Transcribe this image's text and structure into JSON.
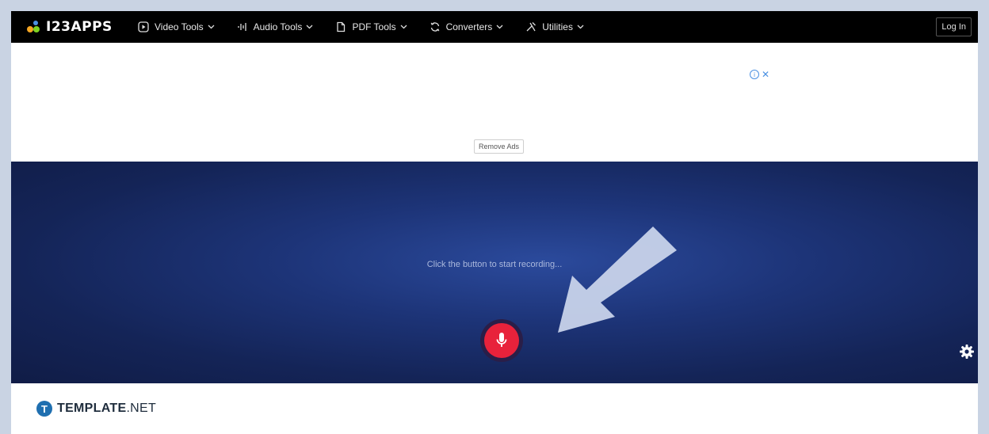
{
  "nav": {
    "logo_text": "I23APPS",
    "items": [
      {
        "label": "Video Tools",
        "icon": "play-circle-icon"
      },
      {
        "label": "Audio Tools",
        "icon": "audio-wave-icon"
      },
      {
        "label": "PDF Tools",
        "icon": "document-icon"
      },
      {
        "label": "Converters",
        "icon": "refresh-icon"
      },
      {
        "label": "Utilities",
        "icon": "tools-icon"
      }
    ],
    "login_label": "Log In"
  },
  "ad": {
    "remove_ads_label": "Remove Ads",
    "adchoices_icon": "info-icon",
    "close_icon": "close-icon"
  },
  "recorder": {
    "hint_text": "Click the button to start recording...",
    "mic_icon": "microphone-icon",
    "settings_icon": "gear-icon"
  },
  "footer": {
    "brand_bold": "TEMPLATE",
    "brand_light": ".NET"
  },
  "colors": {
    "nav_bg": "#000000",
    "mic_red": "#e8223b",
    "recorder_bg": "#1d3478",
    "brand_blue": "#1f6fb0"
  }
}
